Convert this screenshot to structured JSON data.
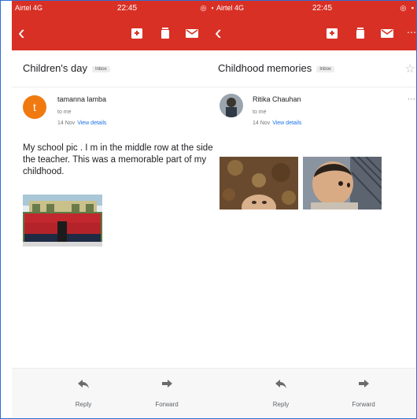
{
  "left": {
    "status": {
      "carrier": "Airtel 4G",
      "time": "22:45"
    },
    "subject": "Children's day",
    "label": "Inbox",
    "sender": {
      "initial": "t",
      "name": "tamanna lamba",
      "to": "to me",
      "date": "14 Nov",
      "details": "View details"
    },
    "body": "My school pic . I m in the middle row at the side of the teacher. This was a memorable part of my childhood.",
    "actions": {
      "reply": "Reply",
      "forward": "Forward"
    }
  },
  "right": {
    "status": {
      "carrier": "Airtel 4G",
      "time": "22:45"
    },
    "subject": "Childhood memories",
    "label": "Inbox",
    "sender": {
      "name": "Ritika Chauhan",
      "to": "to me",
      "date": "14 Nov",
      "details": "View details"
    },
    "actions": {
      "reply": "Reply",
      "forward": "Forward"
    }
  },
  "icons": {
    "back": "back-arrow-icon",
    "archive": "archive-icon",
    "delete": "trash-icon",
    "mail": "mail-icon",
    "star": "star-icon",
    "more": "more-icon",
    "reply": "reply-icon",
    "forward": "forward-icon"
  },
  "colors": {
    "header": "#d93025",
    "link": "#1a73e8",
    "avatar": "#f07a10"
  }
}
